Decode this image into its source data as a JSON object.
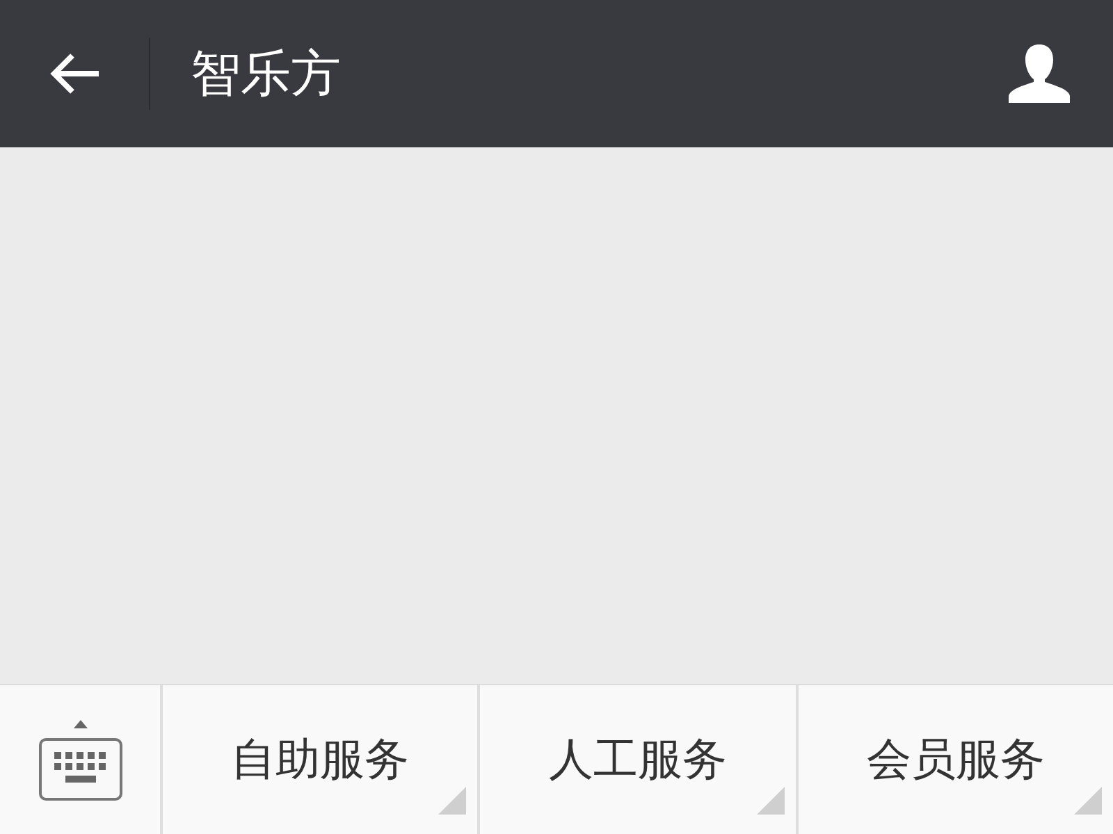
{
  "header": {
    "title": "智乐方"
  },
  "menu": [
    {
      "label": "自助服务",
      "has_submenu": true
    },
    {
      "label": "人工服务",
      "has_submenu": true
    },
    {
      "label": "会员服务",
      "has_submenu": true
    }
  ]
}
